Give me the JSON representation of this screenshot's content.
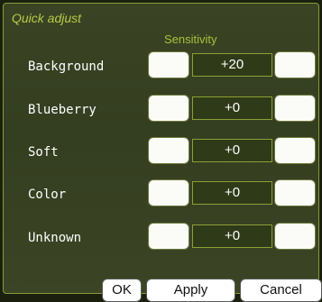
{
  "dialog": {
    "title": "Quick adjust",
    "column_header": "Sensitivity"
  },
  "rows": [
    {
      "label": "Background",
      "value": "+20"
    },
    {
      "label": "Blueberry",
      "value": "+0"
    },
    {
      "label": "Soft",
      "value": "+0"
    },
    {
      "label": "Color",
      "value": "+0"
    },
    {
      "label": "Unknown",
      "value": "+0"
    }
  ],
  "buttons": {
    "ok": "OK",
    "apply": "Apply",
    "cancel": "Cancel"
  },
  "colors": {
    "panel_bg": "#363f22",
    "border": "#8a9a3a",
    "title": "#b9c94a",
    "value_box_bg": "#2f3a18"
  }
}
